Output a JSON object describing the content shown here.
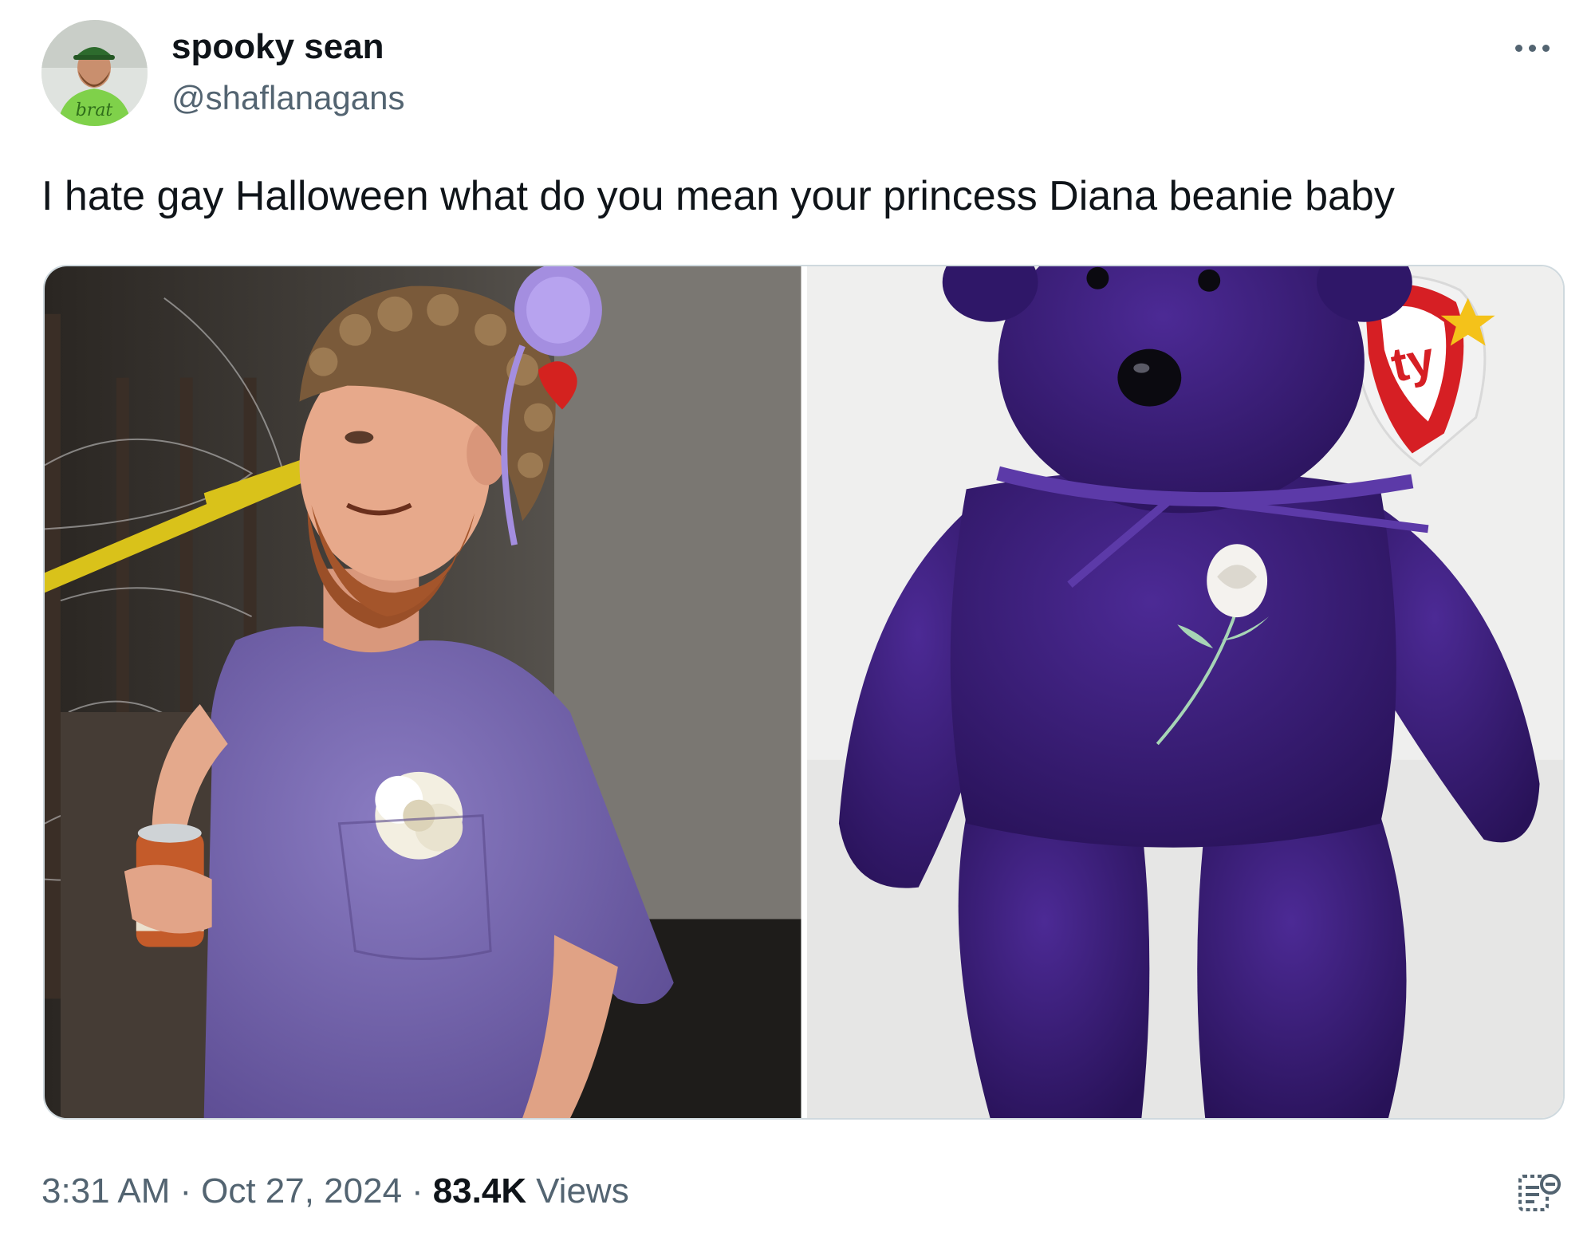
{
  "tweet": {
    "author": {
      "display_name": "spooky sean",
      "handle": "@shaflanagans",
      "avatar_shirt_text": "brat"
    },
    "text": "I hate gay Halloween what do you mean your princess Diana beanie baby",
    "media": [
      {
        "label": "photo-man-in-purple-shirt"
      },
      {
        "label": "photo-princess-diana-beanie-baby"
      }
    ],
    "timestamp": {
      "time": "3:31 AM",
      "date": "Oct 27, 2024"
    },
    "views": {
      "count": "83.4K",
      "label": "Views"
    }
  },
  "colors": {
    "text_primary": "#0f1419",
    "text_secondary": "#536471",
    "border": "#cfd9de",
    "shirt_purple": "#7c6bb0",
    "beanie_purple": "#3b1f7a",
    "avatar_green": "#7fd14a"
  },
  "icons": {
    "more": "more-horizontal-icon",
    "analytics": "post-analytics-icon"
  }
}
